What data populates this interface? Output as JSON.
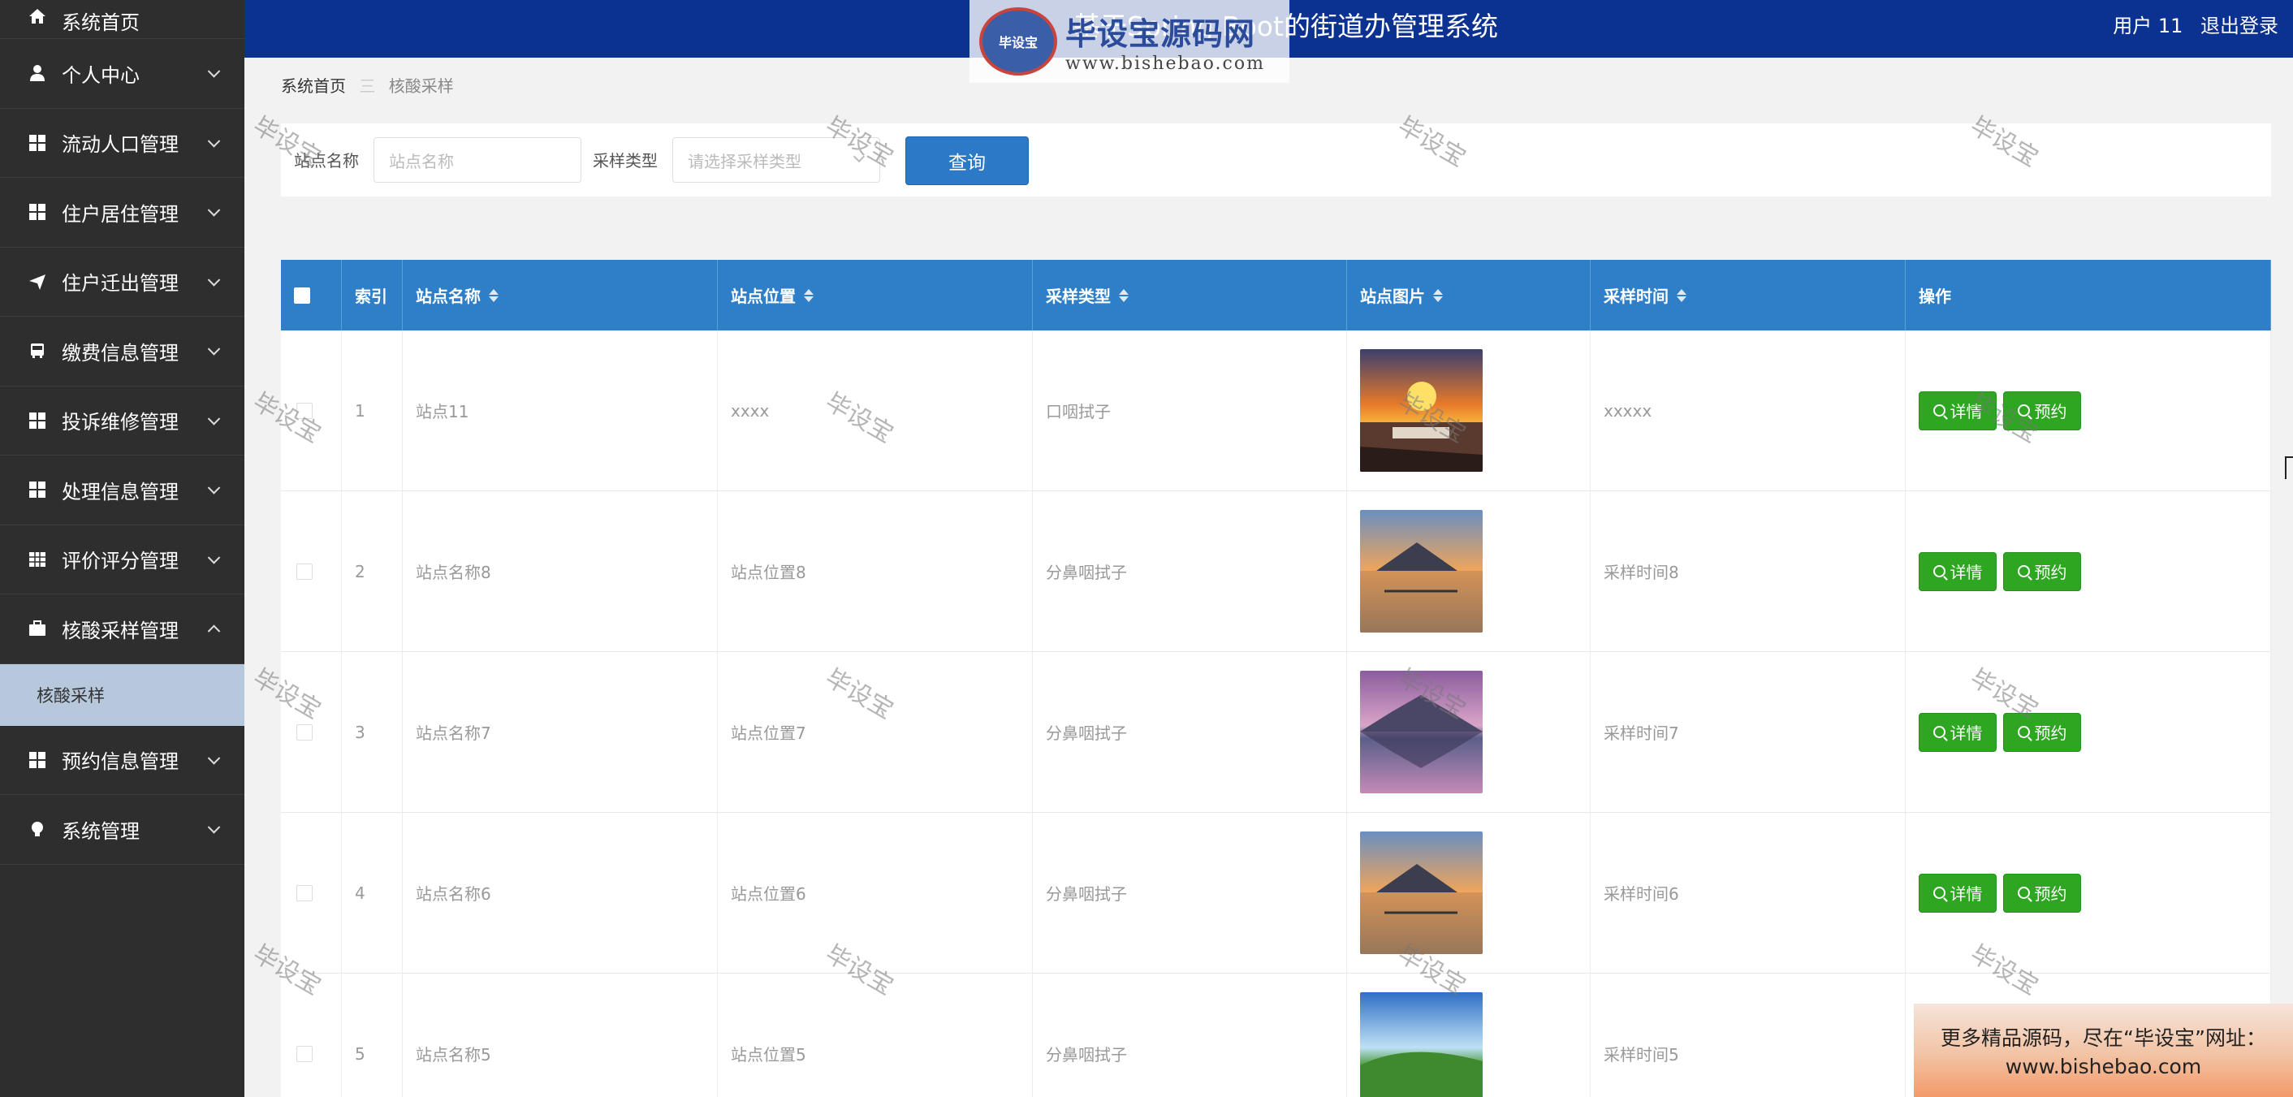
{
  "header": {
    "title": "基于Spring Boot的街道办管理系统",
    "user_label": "用户 11",
    "logout_label": "退出登录"
  },
  "watermark_logo": {
    "badge": "毕设宝",
    "big": "毕设宝源码网",
    "url": "www.bishebao.com"
  },
  "sidebar": {
    "home": "系统首页",
    "items": [
      {
        "label": "个人中心",
        "icon": "user-icon"
      },
      {
        "label": "流动人口管理",
        "icon": "grid-icon"
      },
      {
        "label": "住户居住管理",
        "icon": "grid-icon"
      },
      {
        "label": "住户迁出管理",
        "icon": "send-icon"
      },
      {
        "label": "缴费信息管理",
        "icon": "bus-icon"
      },
      {
        "label": "投诉维修管理",
        "icon": "grid-icon"
      },
      {
        "label": "处理信息管理",
        "icon": "grid-icon"
      },
      {
        "label": "评价评分管理",
        "icon": "table-icon"
      },
      {
        "label": "核酸采样管理",
        "icon": "briefcase-icon"
      },
      {
        "label": "预约信息管理",
        "icon": "grid-icon"
      },
      {
        "label": "系统管理",
        "icon": "bulb-icon"
      }
    ],
    "sub_item": "核酸采样"
  },
  "breadcrumb": {
    "home": "系统首页",
    "separator": "三",
    "current": "核酸采样"
  },
  "search": {
    "station_label": "站点名称",
    "station_placeholder": "站点名称",
    "type_label": "采样类型",
    "type_placeholder": "请选择采样类型",
    "query_button": "查询"
  },
  "table": {
    "headers": [
      "索引",
      "站点名称",
      "站点位置",
      "采样类型",
      "站点图片",
      "采样时间",
      "操作"
    ],
    "rows": [
      {
        "index": "1",
        "name": "站点11",
        "location": "xxxx",
        "type": "口咽拭子",
        "time": "xxxxx",
        "image": "sunset-harbor"
      },
      {
        "index": "2",
        "name": "站点名称8",
        "location": "站点位置8",
        "type": "分鼻咽拭子",
        "time": "采样时间8",
        "image": "mountain-lake-rays"
      },
      {
        "index": "3",
        "name": "站点名称7",
        "location": "站点位置7",
        "type": "分鼻咽拭子",
        "time": "采样时间7",
        "image": "purple-lake"
      },
      {
        "index": "4",
        "name": "站点名称6",
        "location": "站点位置6",
        "type": "分鼻咽拭子",
        "time": "采样时间6",
        "image": "mountain-lake-rays"
      },
      {
        "index": "5",
        "name": "站点名称5",
        "location": "站点位置5",
        "type": "分鼻咽拭子",
        "time": "采样时间5",
        "image": "green-valley"
      }
    ],
    "detail_button": "详情",
    "reserve_button": "预约"
  },
  "watermark_text": "毕设宝",
  "ad": {
    "line1": "更多精品源码，尽在“毕设宝”网址：",
    "line2": "www.bishebao.com"
  },
  "colors": {
    "header_bg": "#0b3191",
    "sidebar_bg": "#2e2e2e",
    "table_header_bg": "#2f7fc8",
    "action_button": "#2ea621",
    "query_button": "#2b79c7"
  }
}
